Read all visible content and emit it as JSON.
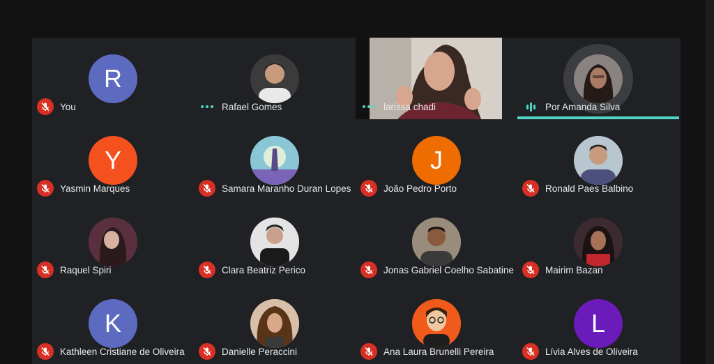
{
  "participants": [
    {
      "name": "You",
      "avatar_letter": "R",
      "avatar_color": "#5c6bc0",
      "status": "muted"
    },
    {
      "name": "Rafael Gomes",
      "avatar_type": "photo",
      "avatar_color": "#3a3a3a",
      "status": "talking-dots"
    },
    {
      "name": "larissa chadi",
      "avatar_type": "video",
      "status": "talking-dots"
    },
    {
      "name": "Por Amanda Silva",
      "avatar_type": "photo",
      "avatar_color": "#4a3f3a",
      "status": "speaking",
      "active_speaker": true
    },
    {
      "name": "Yasmin Marques",
      "avatar_letter": "Y",
      "avatar_color": "#f4511e",
      "status": "muted"
    },
    {
      "name": "Samara Maranho Duran Lopes",
      "avatar_type": "photo",
      "avatar_color": "#7fb8c9",
      "status": "muted"
    },
    {
      "name": "João Pedro Porto",
      "avatar_letter": "J",
      "avatar_color": "#ef6c00",
      "status": "muted"
    },
    {
      "name": "Ronald Paes Balbino",
      "avatar_type": "photo",
      "avatar_color": "#6b8090",
      "status": "muted"
    },
    {
      "name": "Raquel Spiri",
      "avatar_type": "photo",
      "avatar_color": "#6a3b4a",
      "status": "muted"
    },
    {
      "name": "Clara Beatriz Perico",
      "avatar_type": "photo",
      "avatar_color": "#cfcfcf",
      "status": "muted"
    },
    {
      "name": "Jonas Gabriel Coelho Sabatine",
      "avatar_type": "photo",
      "avatar_color": "#7a6a58",
      "status": "muted"
    },
    {
      "name": "Mairim Bazan",
      "avatar_type": "photo",
      "avatar_color": "#5a2a3a",
      "status": "muted"
    },
    {
      "name": "Kathleen Cristiane de Oliveira",
      "avatar_letter": "K",
      "avatar_color": "#5c6bc0",
      "status": "muted"
    },
    {
      "name": "Danielle Peraccini",
      "avatar_type": "photo",
      "avatar_color": "#c8a888",
      "status": "muted"
    },
    {
      "name": "Ana Laura Brunelli Pereira",
      "avatar_type": "photo",
      "avatar_color": "#f05a1a",
      "status": "muted"
    },
    {
      "name": "Lívia Alves de Oliveira",
      "avatar_letter": "L",
      "avatar_color": "#6a1bb9",
      "status": "muted"
    }
  ],
  "colors": {
    "accent": "#4fd6c7",
    "muted_badge": "#d93025",
    "stage_bg": "#202124"
  }
}
